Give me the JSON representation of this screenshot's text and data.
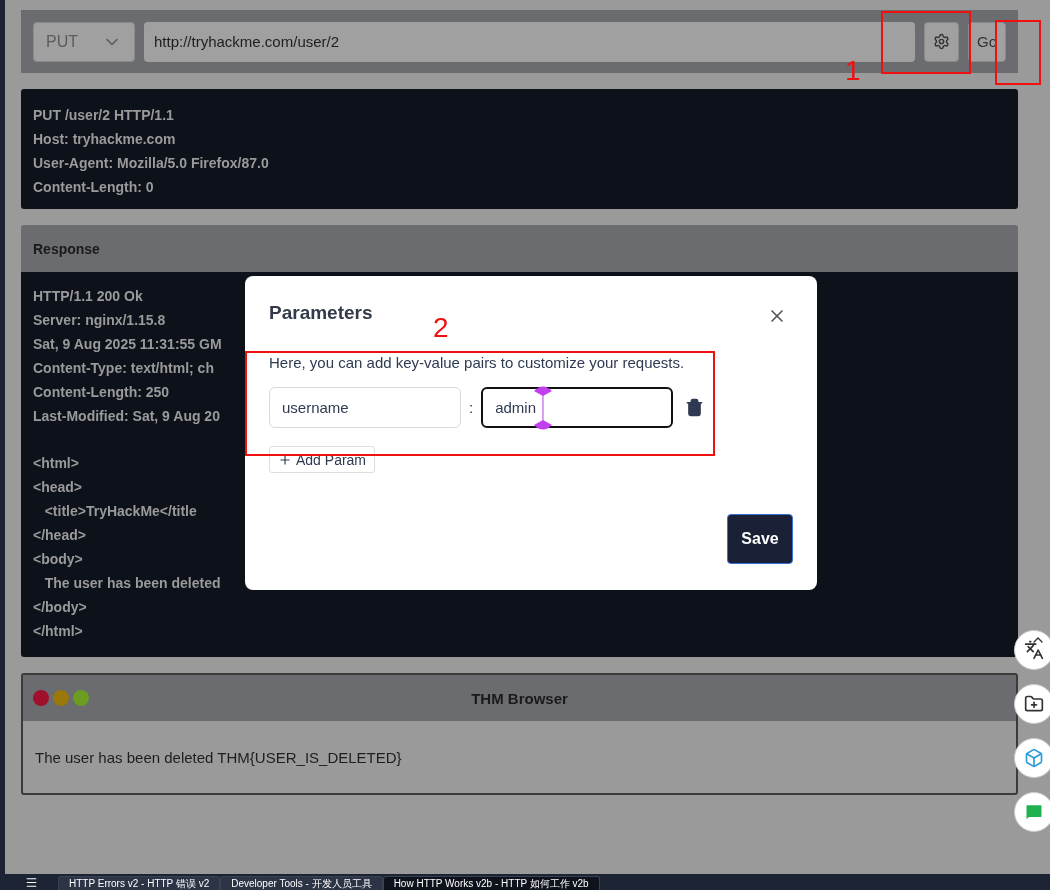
{
  "request_bar": {
    "method": "PUT",
    "url": "http://tryhackme.com/user/2",
    "go_label": "Go"
  },
  "request": {
    "lines": [
      "PUT /user/2 HTTP/1.1",
      "Host: tryhackme.com",
      "User-Agent: Mozilla/5.0 Firefox/87.0",
      "Content-Length: 0"
    ]
  },
  "response": {
    "title": "Response",
    "headers": [
      "HTTP/1.1 200 Ok",
      "Server: nginx/1.15.8",
      "Sat, 9 Aug 2025 11:31:55 GM",
      "Content-Type: text/html; ch",
      "Content-Length: 250",
      "Last-Modified: Sat, 9 Aug 20"
    ],
    "body": [
      "<html>",
      "<head>",
      "   <title>TryHackMe</title",
      "</head>",
      "<body>",
      "   The user has been deleted",
      "</body>",
      "</html>"
    ]
  },
  "browser": {
    "title": "THM Browser",
    "dots": [
      {
        "color": "#a0102c"
      },
      {
        "color": "#9a780c"
      },
      {
        "color": "#6c9c22"
      }
    ],
    "body": "The user has been deleted THM{USER_IS_DELETED}"
  },
  "dialog": {
    "title": "Parameters",
    "description": "Here, you can add key-value pairs to customize your requests.",
    "params": [
      {
        "key": "username",
        "value": "admin",
        "focused": true
      }
    ],
    "separator": ":",
    "add_label": "Add Param",
    "save_label": "Save"
  },
  "annotations": [
    {
      "label": "1"
    },
    {
      "label": "2"
    }
  ],
  "taskbar": {
    "tabs": [
      {
        "label": "HTTP Errors v2 - HTTP 错误 v2",
        "selected": false
      },
      {
        "label": "Developer Tools - 开发人员工具",
        "selected": false
      },
      {
        "label": "How HTTP Works v2b - HTTP 如何工作 v2b",
        "selected": true
      }
    ]
  }
}
